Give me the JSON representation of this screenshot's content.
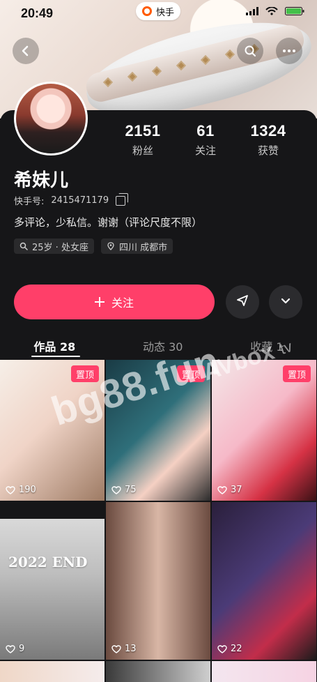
{
  "status": {
    "time": "20:49",
    "app_pill": "快手"
  },
  "profile": {
    "name": "希妹儿",
    "id_label": "快手号:",
    "id_value": "2415471179",
    "bio": "多评论，少私信。谢谢（评论尺度不限）",
    "tags": [
      "25岁 · 处女座",
      "四川 成都市"
    ],
    "stats": [
      {
        "value": "2151",
        "label": "粉丝"
      },
      {
        "value": "61",
        "label": "关注"
      },
      {
        "value": "1324",
        "label": "获赞"
      }
    ]
  },
  "actions": {
    "follow_label": "关注"
  },
  "tabs": [
    {
      "label": "作品 28",
      "active": true
    },
    {
      "label": "动态 30",
      "active": false
    },
    {
      "label": "收藏 1",
      "active": false
    }
  ],
  "grid": {
    "pin_label": "置顶",
    "items": [
      {
        "likes": "190",
        "pinned": true,
        "overlay": ""
      },
      {
        "likes": "75",
        "pinned": true,
        "overlay": ""
      },
      {
        "likes": "37",
        "pinned": true,
        "overlay": ""
      },
      {
        "likes": "9",
        "pinned": false,
        "overlay": "2022 END"
      },
      {
        "likes": "13",
        "pinned": false,
        "overlay": ""
      },
      {
        "likes": "22",
        "pinned": false,
        "overlay": ""
      }
    ]
  },
  "watermarks": {
    "big": "bg88.fun",
    "small": "AVbox",
    "tv": "tv"
  },
  "icons": {
    "back": "back-arrow-icon",
    "search": "search-icon",
    "more": "more-icon",
    "filter": "send-icon",
    "dropdown": "chevron-down-icon",
    "copy": "copy-icon",
    "location": "location-pin-icon",
    "age": "search-tag-icon",
    "heart": "heart-icon"
  }
}
